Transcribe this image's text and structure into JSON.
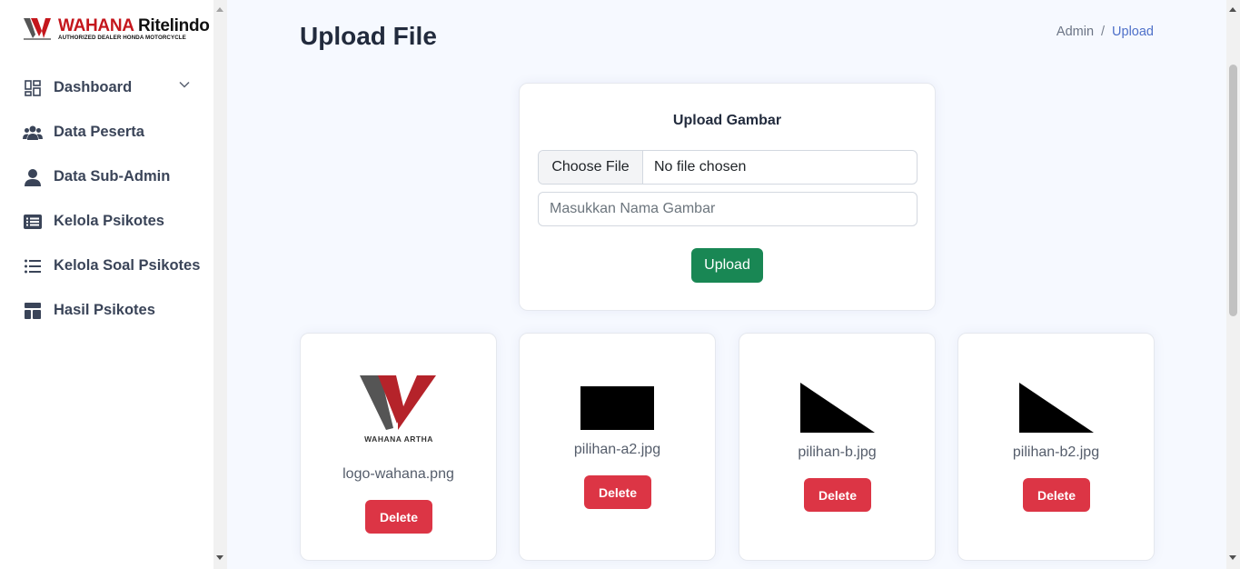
{
  "brand": {
    "name_part1": "WAHANA",
    "name_part2": "Ritelindo",
    "tagline": "AUTHORIZED DEALER HONDA MOTORCYCLE",
    "colors": {
      "red": "#c4161c",
      "gray": "#555555"
    }
  },
  "sidebar": {
    "items": [
      {
        "label": "Dashboard",
        "icon": "grid-icon",
        "has_chevron": true
      },
      {
        "label": "Data Peserta",
        "icon": "people-icon"
      },
      {
        "label": "Data Sub-Admin",
        "icon": "person-icon"
      },
      {
        "label": "Kelola Psikotes",
        "icon": "card-list-icon"
      },
      {
        "label": "Kelola Soal Psikotes",
        "icon": "list-icon"
      },
      {
        "label": "Hasil Psikotes",
        "icon": "layout-icon"
      }
    ]
  },
  "header": {
    "title": "Upload File",
    "breadcrumb": [
      "Admin",
      "Upload"
    ],
    "breadcrumb_separator": "/"
  },
  "upload_form": {
    "title": "Upload Gambar",
    "file_button": "Choose File",
    "file_status": "No file chosen",
    "name_placeholder": "Masukkan Nama Gambar",
    "name_value": "",
    "submit_label": "Upload",
    "submit_color": "#198754"
  },
  "gallery": {
    "delete_label": "Delete",
    "delete_color": "#dc3545",
    "items": [
      {
        "filename": "logo-wahana.png",
        "logo_caption": "WAHANA ARTHA",
        "thumb": "wahana-logo"
      },
      {
        "filename": "pilihan-a2.jpg",
        "thumb": "black-rectangle"
      },
      {
        "filename": "pilihan-b.jpg",
        "thumb": "black-triangle"
      },
      {
        "filename": "pilihan-b2.jpg",
        "thumb": "black-triangle"
      }
    ]
  }
}
